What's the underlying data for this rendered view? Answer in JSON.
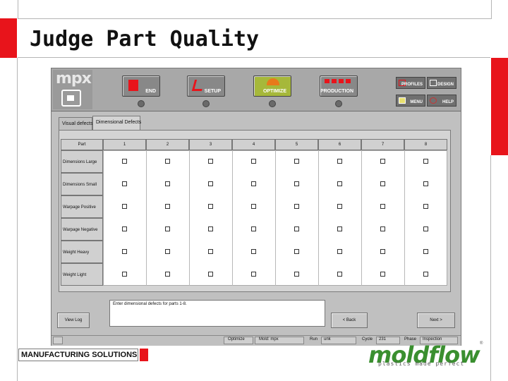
{
  "slide": {
    "title": "Judge Part Quality",
    "footer": "MANUFACTURING SOLUTIONS",
    "accent_color": "#e8141b",
    "brand": {
      "name": "moldflow",
      "tagline": "plastics made perfect",
      "reg": "®",
      "color": "#3a8f2f"
    }
  },
  "app": {
    "logo": "mpx",
    "toolbar": [
      {
        "label": "END",
        "icon": "stop-icon"
      },
      {
        "label": "SETUP",
        "icon": "setup-icon"
      },
      {
        "label": "OPTIMIZE",
        "icon": "gauge-icon"
      },
      {
        "label": "PRODUCTION",
        "icon": "production-icon"
      }
    ],
    "side_buttons": {
      "profiles": "PROFILES",
      "design": "DESIGN",
      "menu": "MENU",
      "help": "HELP"
    },
    "tabs": [
      "Visual defects",
      "Dimensional Defects"
    ],
    "grid": {
      "corner": "Part",
      "columns": [
        "1",
        "2",
        "3",
        "4",
        "5",
        "6",
        "7",
        "8"
      ],
      "rows": [
        "Dimensions Large",
        "Dimensions Small",
        "Warpage Positive",
        "Warpage Negative",
        "Weight Heavy",
        "Weight Light"
      ]
    },
    "buttons": {
      "left": "View Log",
      "back": "< Back",
      "next": "Next >"
    },
    "message": "Enter dimensional defects for parts 1-8.",
    "status": {
      "optimize_label": "Optimize",
      "mode": "Mold: mpx",
      "run_label": "Run",
      "run_value": "unk",
      "cycle_label": "Cycle",
      "cycle_value": "231",
      "phase_label": "Phase",
      "phase_value": "Inspection"
    }
  }
}
